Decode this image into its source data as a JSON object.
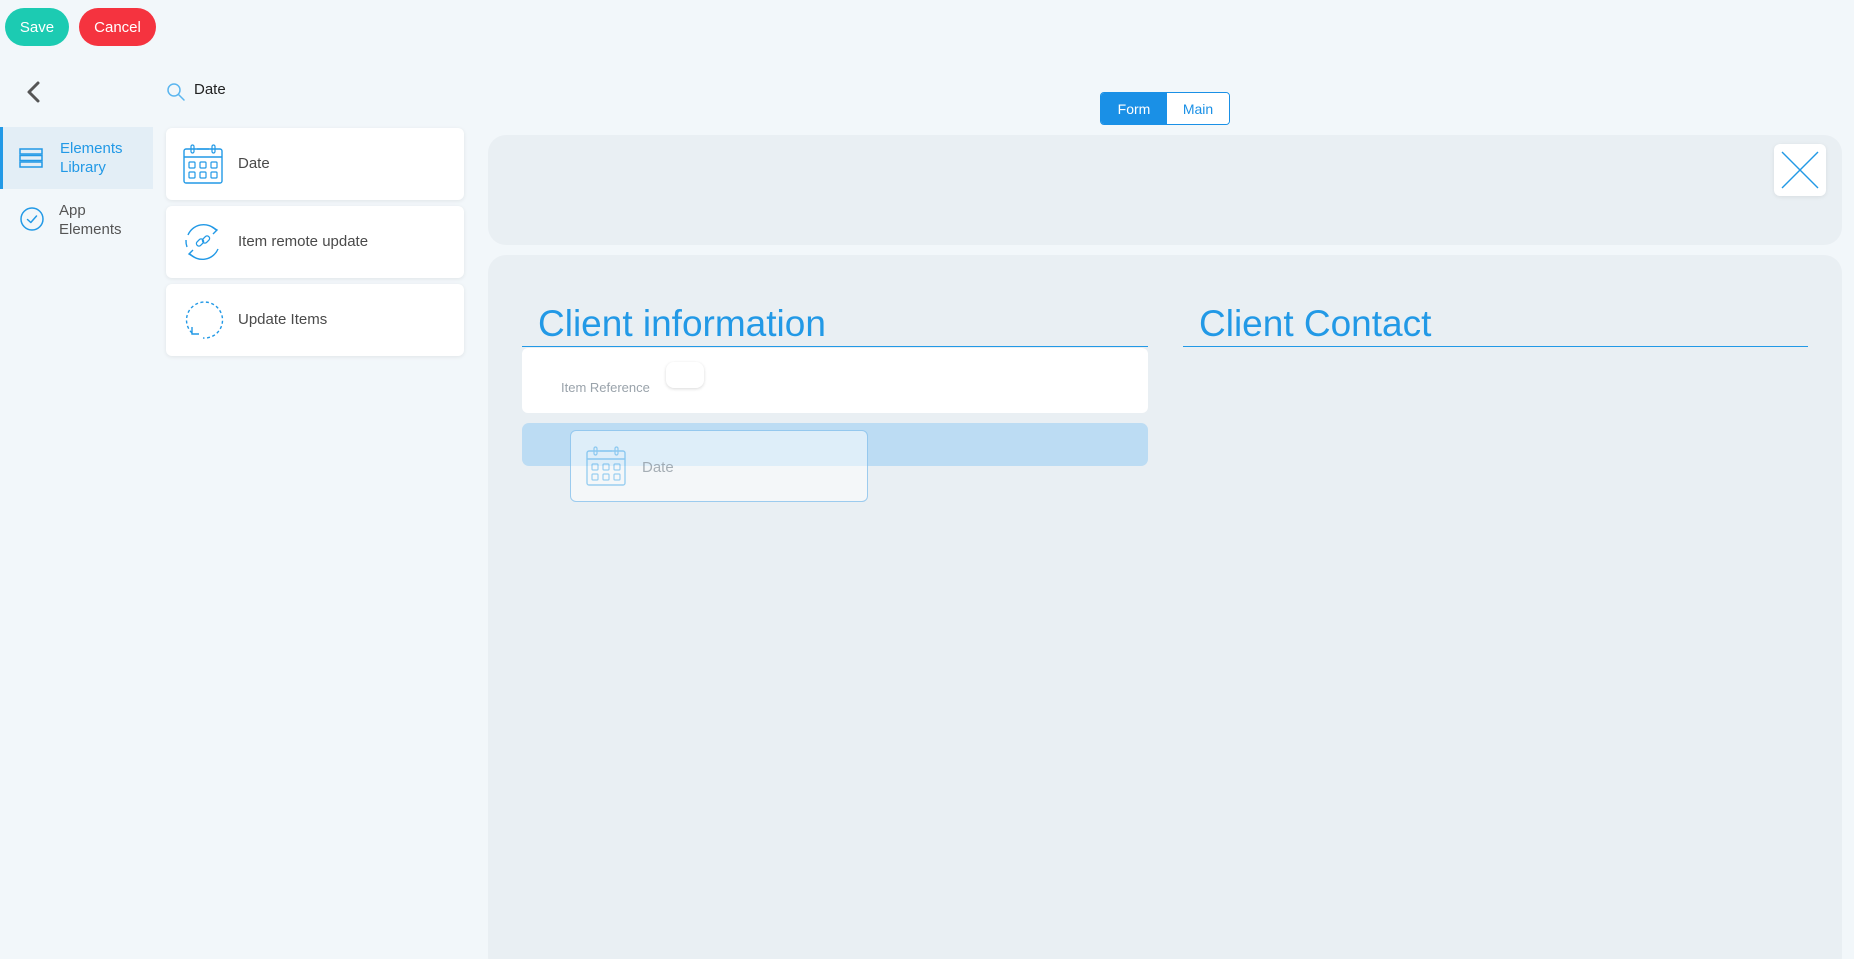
{
  "toolbar": {
    "save_label": "Save",
    "cancel_label": "Cancel"
  },
  "sidebar": {
    "back_icon": "chevron-left-icon",
    "items": [
      {
        "label": "Elements Library",
        "icon": "stack-icon",
        "active": true
      },
      {
        "label": "App Elements",
        "icon": "check-circle-icon",
        "active": false
      }
    ]
  },
  "search": {
    "value": "Date",
    "icon": "search-icon"
  },
  "library": [
    {
      "label": "Date",
      "icon": "calendar-icon"
    },
    {
      "label": "Item remote update",
      "icon": "link-sync-icon"
    },
    {
      "label": "Update Items",
      "icon": "refresh-circle-icon"
    }
  ],
  "view_toggle": {
    "options": [
      "Form",
      "Main"
    ],
    "selected": "Form"
  },
  "canvas": {
    "sections": [
      {
        "title": "Client information"
      },
      {
        "title": "Client Contact"
      }
    ],
    "fields": [
      {
        "label": "Item Reference"
      }
    ],
    "dragging": {
      "label": "Date",
      "icon": "calendar-icon"
    }
  },
  "colors": {
    "accent": "#2299e6",
    "save": "#1ccbb2",
    "cancel": "#f5333f",
    "drop_zone": "#bcdcf3"
  }
}
